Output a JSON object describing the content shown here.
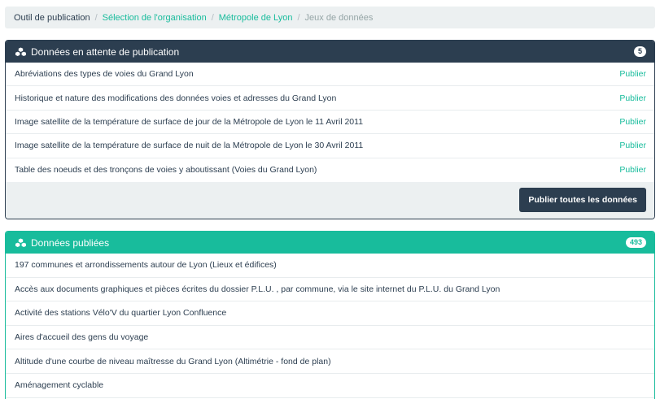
{
  "breadcrumb": {
    "root": "Outil de publication",
    "org_select": "Sélection de l'organisation",
    "org": "Métropole de Lyon",
    "current": "Jeux de données",
    "separator": "/"
  },
  "pending": {
    "title": "Données en attente de publication",
    "count": "5",
    "publish_label": "Publier",
    "items": [
      "Abréviations des types de voies du Grand Lyon",
      "Historique et nature des modifications des données voies et adresses du Grand Lyon",
      "Image satellite de la température de surface de jour de la Métropole de Lyon le 11 Avril 2011",
      "Image satellite de la température de surface de nuit de la Métropole de Lyon le 30 Avril 2011",
      "Table des noeuds et des tronçons de voies y aboutissant (Voies du Grand Lyon)"
    ],
    "publish_all_label": "Publier toutes les données"
  },
  "published": {
    "title": "Données publiées",
    "count": "493",
    "items": [
      "197 communes et arrondissements autour de Lyon (Lieux et édifices)",
      "Accès aux documents graphiques et pièces écrites du dossier P.L.U. , par commune, via le site internet du P.L.U. du Grand Lyon",
      "Activité des stations Vélo'V du quartier Lyon Confluence",
      "Aires d'accueil des gens du voyage",
      "Altitude d'une courbe de niveau maîtresse du Grand Lyon (Altimétrie - fond de plan)",
      "Aménagement cyclable"
    ]
  },
  "colors": {
    "primary": "#2c3e50",
    "success": "#18bc9c",
    "light": "#ecf0f1"
  },
  "icons": {
    "dataset": "cubes-icon"
  }
}
